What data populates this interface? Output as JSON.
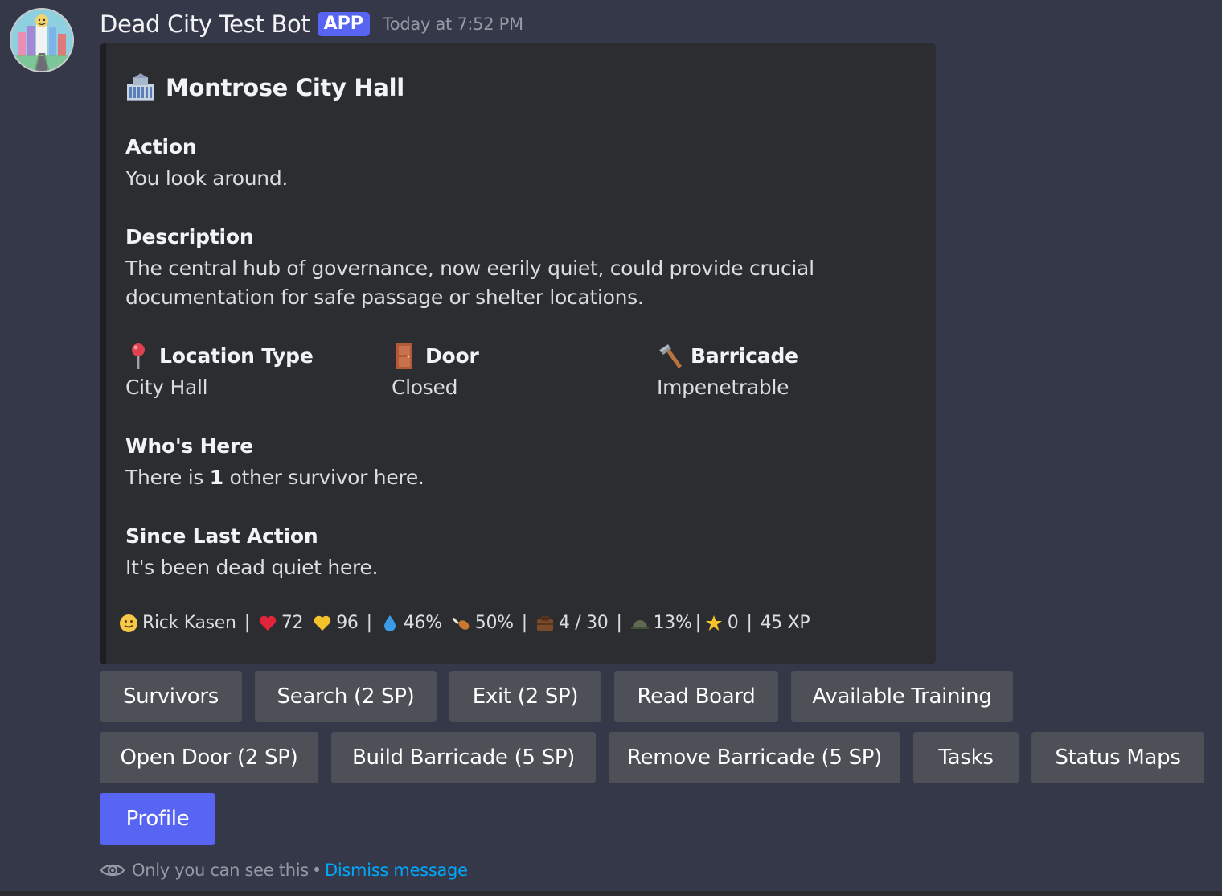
{
  "header": {
    "bot_name": "Dead City Test Bot",
    "badge": "APP",
    "timestamp": "Today at 7:52 PM"
  },
  "embed": {
    "title_icon": "city-hall-building-icon",
    "title": "Montrose City Hall",
    "action": {
      "name": "Action",
      "value": "You look around."
    },
    "description": {
      "name": "Description",
      "lines": [
        "The central hub of governance, now eerily quiet, could provide crucial",
        "documentation for safe passage or shelter locations."
      ]
    },
    "location_type": {
      "icon": "round-pushpin-icon",
      "name": "Location Type",
      "value": "City Hall"
    },
    "door": {
      "icon": "door-icon",
      "name": "Door",
      "value": "Closed"
    },
    "barricade": {
      "icon": "hammer-icon",
      "name": "Barricade",
      "value": "Impenetrable"
    },
    "whos_here": {
      "name": "Who's Here",
      "prefix": "There is ",
      "count": "1",
      "suffix": " other survivor here."
    },
    "since_last_action": {
      "name": "Since Last Action",
      "value": "It's been dead quiet here."
    },
    "footer": {
      "player_name": "Rick Kasen",
      "health": "72",
      "stamina": "96",
      "water": "46%",
      "food": "50%",
      "inventory": "4 / 30",
      "armor": "13%",
      "stars": "0",
      "xp": "45 XP"
    }
  },
  "buttons": {
    "row1": [
      "Survivors",
      "Search (2 SP)",
      "Exit (2 SP)",
      "Read Board",
      "Available Training"
    ],
    "row2": [
      "Open Door (2 SP)",
      "Build Barricade (5 SP)",
      "Remove Barricade (5 SP)",
      "Tasks",
      "Status Maps"
    ],
    "row3": [
      "Profile"
    ]
  },
  "ephemeral": {
    "text": "Only you can see this",
    "separator": "•",
    "dismiss": "Dismiss message"
  },
  "colors": {
    "background": "#353849",
    "embed_background": "#2b2d31",
    "button_secondary": "#4e5058",
    "button_primary": "#5865f2",
    "link": "#00a8fc",
    "badge": "#5865f2"
  }
}
